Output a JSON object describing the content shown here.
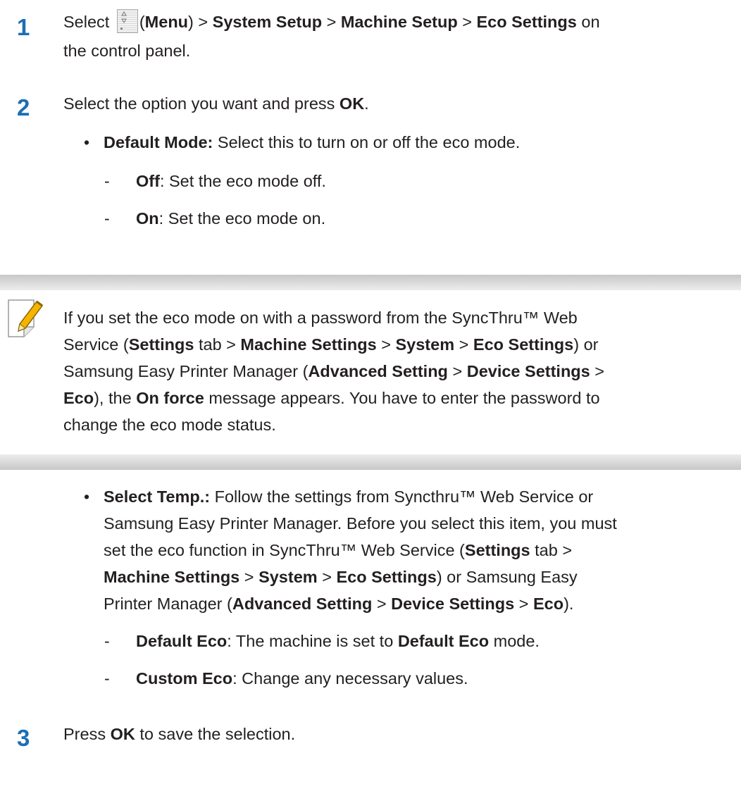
{
  "step1": {
    "number": "1",
    "pre": "Select ",
    "icon_name": "menu-icon",
    "paren_open": "(",
    "menu": "Menu",
    "paren_close": ") > ",
    "sys_setup": "System Setup",
    "sep1": " > ",
    "machine_setup": "Machine Setup",
    "sep2": " > ",
    "eco_settings": "Eco Settings",
    "post": " on",
    "line2": "the control panel."
  },
  "step2": {
    "number": "2",
    "pre": "Select the option you want and press ",
    "ok": "OK",
    "post": ".",
    "bullet_char": "•",
    "default_mode_label": "Default Mode:",
    "default_mode_text": " Select this to turn on or off the eco mode.",
    "dash_char": "-",
    "off_label": "Off",
    "off_text": ": Set the eco mode off.",
    "on_label": "On",
    "on_text": ": Set the eco mode on."
  },
  "note": {
    "icon_name": "note-pencil-icon",
    "l1": "If you set the eco mode on with a password from the SyncThru™ Web",
    "l2_pre": "Service (",
    "l2_settings": "Settings",
    "l2_tab": " tab > ",
    "l2_machine_settings": "Machine Settings",
    "l2_sep1": " > ",
    "l2_system": "System",
    "l2_sep2": " > ",
    "l2_eco_settings": "Eco Settings",
    "l2_post": ") or",
    "l3_pre": "Samsung Easy Printer Manager (",
    "l3_advanced": "Advanced Setting",
    "l3_sep": " > ",
    "l3_device": "Device Settings",
    "l3_post": " >",
    "l4_eco": "Eco",
    "l4_mid": "), the ",
    "l4_onforce": "On force",
    "l4_post": " message appears. You have to enter the password to",
    "l5": "change the eco mode status."
  },
  "select_temp": {
    "bullet_char": "•",
    "label": "Select Temp.:",
    "l1_text": " Follow the settings from Syncthru™ Web Service or",
    "l2": "Samsung Easy Printer Manager. Before you select this item, you must",
    "l3_pre": "set the eco function in SyncThru™ Web Service (",
    "l3_settings": "Settings",
    "l3_post": " tab >",
    "l4_machine_settings": "Machine Settings",
    "l4_sep1": " > ",
    "l4_system": "System",
    "l4_sep2": " > ",
    "l4_eco_settings": "Eco Settings",
    "l4_post": ") or Samsung Easy",
    "l5_pre": "Printer Manager (",
    "l5_advanced": "Advanced Setting",
    "l5_sep1": " > ",
    "l5_device": "Device Settings",
    "l5_sep2": " > ",
    "l5_eco": "Eco",
    "l5_post": ").",
    "dash_char": "-",
    "default_eco_label": "Default Eco",
    "default_eco_mid": ": The machine is set to ",
    "default_eco_bold": "Default Eco",
    "default_eco_post": " mode.",
    "custom_eco_label": "Custom Eco",
    "custom_eco_text": ": Change any necessary values."
  },
  "step3": {
    "number": "3",
    "pre": "Press ",
    "ok": "OK",
    "post": " to save the selection."
  },
  "colors": {
    "step_number": "#1a6fb5",
    "text": "#231f20",
    "note_band": "#c7c7c7"
  }
}
